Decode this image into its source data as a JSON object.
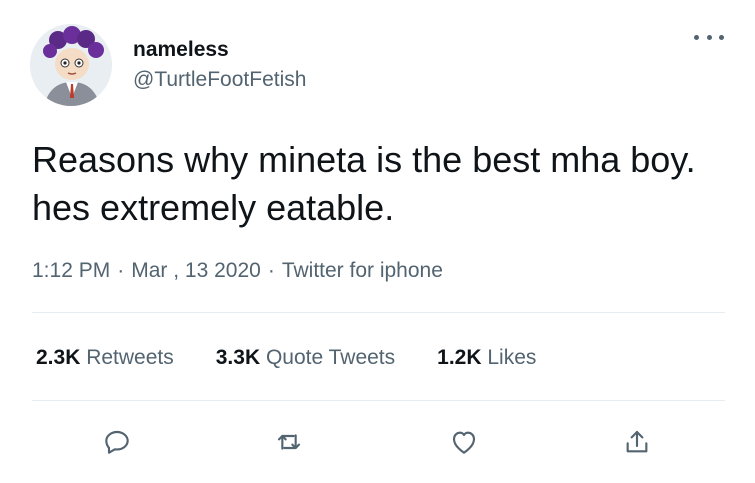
{
  "user": {
    "display_name": "nameless",
    "handle": "@TurtleFootFetish",
    "avatar_icon": "anime-character-avatar"
  },
  "tweet": {
    "text": "Reasons why mineta is the best mha boy. hes extremely eatable.",
    "time": "1:12 PM",
    "date": "Mar , 13 2020",
    "source": "Twitter for iphone",
    "separator": "·"
  },
  "stats": {
    "retweets_count": "2.3K",
    "retweets_label": "Retweets",
    "quote_count": "3.3K",
    "quote_label": "Quote Tweets",
    "likes_count": "1.2K",
    "likes_label": "Likes"
  },
  "actions": {
    "reply_icon": "reply-icon",
    "retweet_icon": "retweet-icon",
    "like_icon": "heart-icon",
    "share_icon": "share-icon"
  },
  "colors": {
    "text": "#0f1419",
    "secondary": "#536471",
    "divider": "#e6ecf0"
  }
}
